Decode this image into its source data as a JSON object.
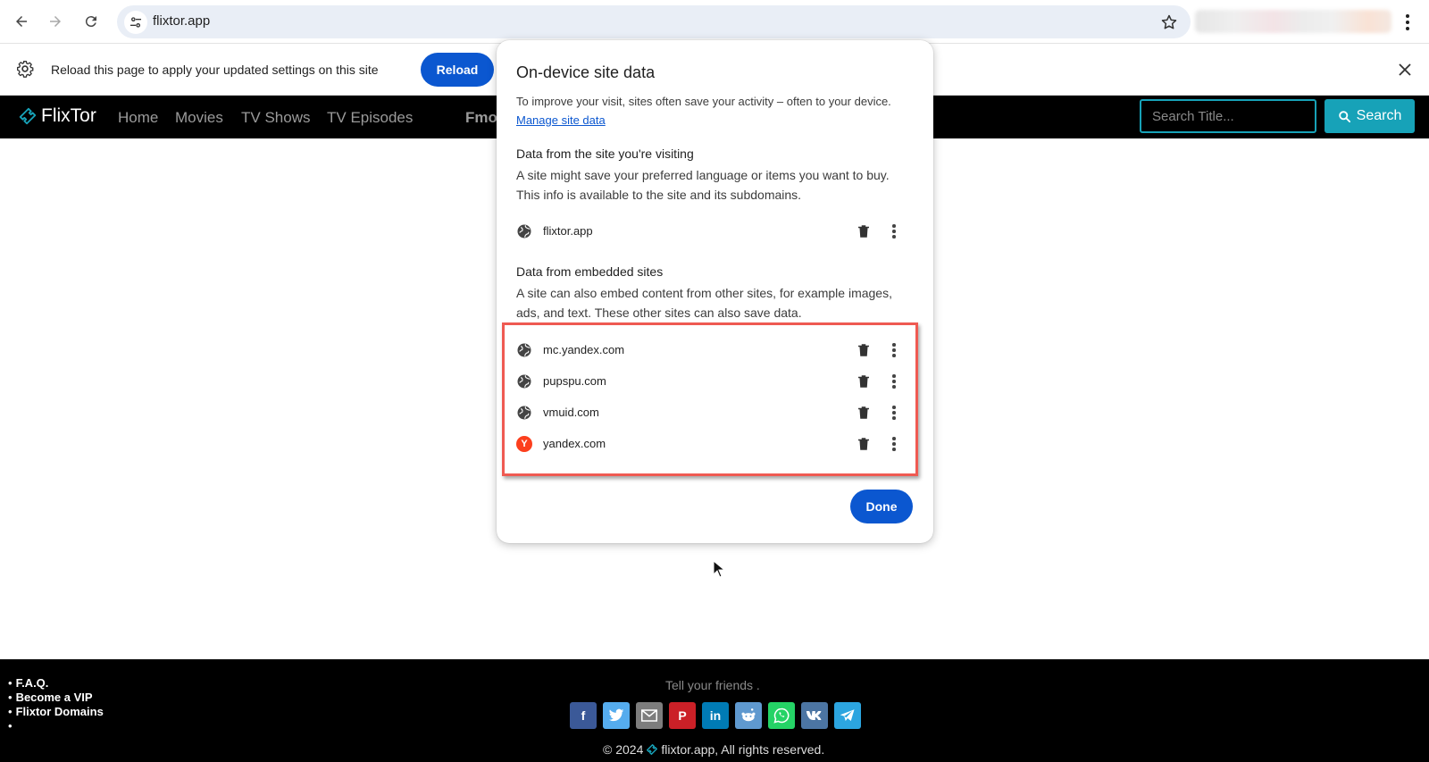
{
  "browser": {
    "url": "flixtor.app"
  },
  "infobar": {
    "message": "Reload this page to apply your updated settings on this site",
    "reload_label": "Reload"
  },
  "site": {
    "logo_text": "FlixTor",
    "nav": [
      "Home",
      "Movies",
      "TV Shows",
      "TV Episodes"
    ],
    "nav_partial": "Fmo",
    "search_placeholder": "Search Title...",
    "search_label": "Search"
  },
  "dialog": {
    "title": "On-device site data",
    "description": "To improve your visit, sites often save your activity – often to your device.",
    "manage_link": "Manage site data",
    "section1_heading": "Data from the site you're visiting",
    "section1_text": "A site might save your preferred language or items you want to buy. This info is available to the site and its subdomains.",
    "visiting_site": "flixtor.app",
    "section2_heading": "Data from embedded sites",
    "section2_text": "A site can also embed content from other sites, for example images, ads, and text. These other sites can also save data.",
    "embedded_sites": [
      "mc.yandex.com",
      "pupspu.com",
      "vmuid.com",
      "yandex.com"
    ],
    "done_label": "Done"
  },
  "footer": {
    "links": [
      "F.A.Q.",
      "Become a VIP",
      "Flixtor Domains",
      ""
    ],
    "tell": "Tell your friends .",
    "share_icons": [
      "facebook-icon",
      "twitter-icon",
      "email-icon",
      "pinterest-icon",
      "linkedin-icon",
      "reddit-icon",
      "whatsapp-icon",
      "vk-icon",
      "telegram-icon"
    ],
    "copyright_pre": "© 2024",
    "copyright_post": "flixtor.app, All rights reserved."
  },
  "colors": {
    "accent_blue": "#0b57d0",
    "search_teal": "#17a2b8",
    "highlight_red": "#ef5a52"
  }
}
